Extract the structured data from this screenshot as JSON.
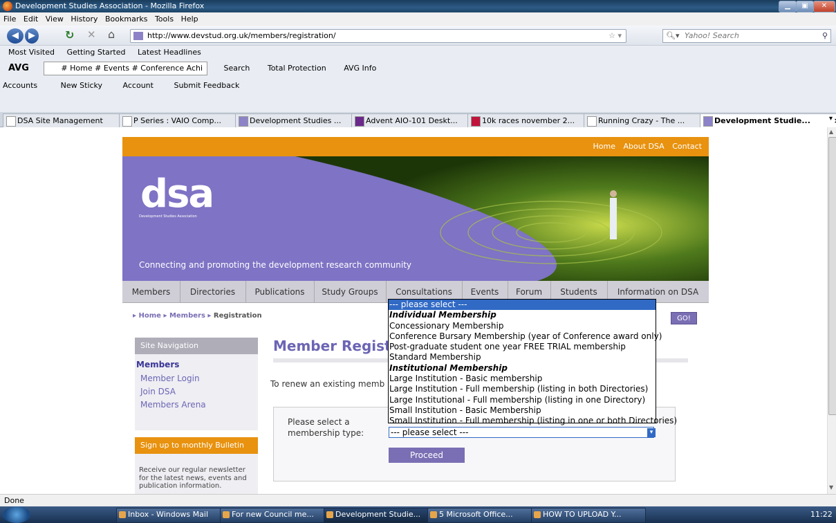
{
  "window": {
    "title": "Development Studies Association - Mozilla Firefox"
  },
  "menu": [
    "File",
    "Edit",
    "View",
    "History",
    "Bookmarks",
    "Tools",
    "Help"
  ],
  "url": "http://www.devstud.org.uk/members/registration/",
  "search_placeholder": "Yahoo! Search",
  "bookmarks": {
    "most_visited": "Most Visited",
    "getting_started": "Getting Started",
    "latest_headlines": "Latest Headlines"
  },
  "avg": {
    "name": "AVG",
    "dropdown": "# Home # Events # Conference Achi",
    "search": "Search",
    "protection": "Total Protection",
    "info": "AVG Info"
  },
  "accounts": {
    "accounts": "Accounts",
    "new_sticky": "New Sticky",
    "account": "Account",
    "feedback": "Submit Feedback"
  },
  "tabs": [
    "DSA Site Management",
    "P Series : VAIO Comp...",
    "Development Studies ...",
    "Advent AIO-101 Deskt...",
    "10k races november 2...",
    "Running Crazy - The ...",
    "Development Studie..."
  ],
  "site": {
    "top_links": [
      "Home",
      "About DSA",
      "Contact"
    ],
    "logo_text": "dsa",
    "logo_sub": "Development Studies Association",
    "tagline": "Connecting and promoting the development research community",
    "nav": [
      "Members",
      "Directories",
      "Publications",
      "Study Groups",
      "Consultations",
      "Events",
      "Forum",
      "Students",
      "Information on DSA"
    ],
    "breadcrumb": [
      "Home",
      "Members",
      "Registration"
    ],
    "go": "GO!",
    "sidebar": {
      "nav_title": "Site Navigation",
      "section": "Members",
      "links": [
        "Member Login",
        "Join DSA",
        "Members Arena"
      ],
      "bulletin_title": "Sign up to monthly Bulletin",
      "bulletin_text": "Receive our regular newsletter for the latest news, events and publication information."
    },
    "main": {
      "heading": "Member Registra",
      "renew_text": "To renew an existing memb",
      "select_label_1": "Please select a",
      "select_label_2": "membership type:",
      "select_value": "--- please select ---",
      "proceed": "Proceed"
    }
  },
  "dropdown_options": [
    "--- please select ---",
    "Individual Membership",
    "Concessionary Membership",
    "Conference Bursary Membership (year of Conference award only)",
    "Post-graduate student one year FREE TRIAL membership",
    "Standard Membership",
    "Institutional Membership",
    "Large Institution - Basic membership",
    "Large Institution - Full membership (listing in both Directories)",
    "Large Institutional - Full membership (listing in one Directory)",
    "Small Institution - Basic Membership",
    "Small Institution - Full membership (listing in one or both Directories)"
  ],
  "status": "Done",
  "taskbar": {
    "tasks": [
      "Inbox - Windows Mail",
      "For new Council me...",
      "Development Studie...",
      "5 Microsoft Office...",
      "HOW TO UPLOAD Y..."
    ],
    "clock": "11:22"
  }
}
